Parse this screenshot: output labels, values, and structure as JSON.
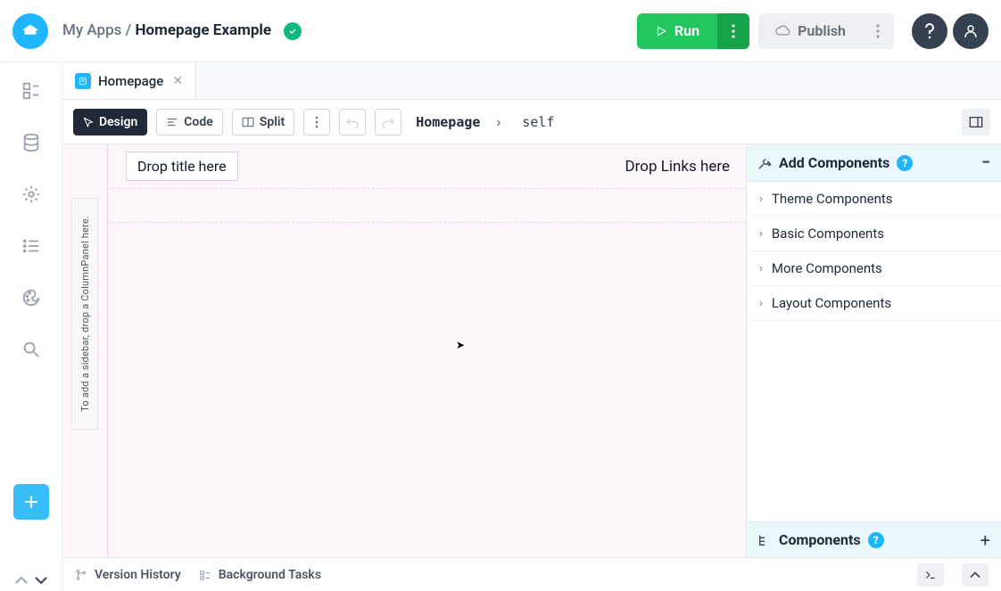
{
  "header": {
    "breadcrumb_parent": "My Apps",
    "breadcrumb_separator": "/",
    "breadcrumb_current": "Homepage Example",
    "run_label": "Run",
    "publish_label": "Publish"
  },
  "tabs": [
    {
      "label": "Homepage"
    }
  ],
  "toolbar": {
    "design_label": "Design",
    "code_label": "Code",
    "split_label": "Split",
    "breadcrumb_root": "Homepage",
    "breadcrumb_leaf": "self"
  },
  "canvas": {
    "sidebar_hint": "To add a sidebar, drop a ColumnPanel here.",
    "title_placeholder": "Drop title here",
    "links_placeholder": "Drop Links here"
  },
  "right_panel": {
    "add_components_title": "Add Components",
    "groups": [
      {
        "label": "Theme Components"
      },
      {
        "label": "Basic Components"
      },
      {
        "label": "More Components"
      },
      {
        "label": "Layout Components"
      }
    ],
    "components_title": "Components"
  },
  "bottom": {
    "version_history": "Version History",
    "background_tasks": "Background Tasks"
  }
}
